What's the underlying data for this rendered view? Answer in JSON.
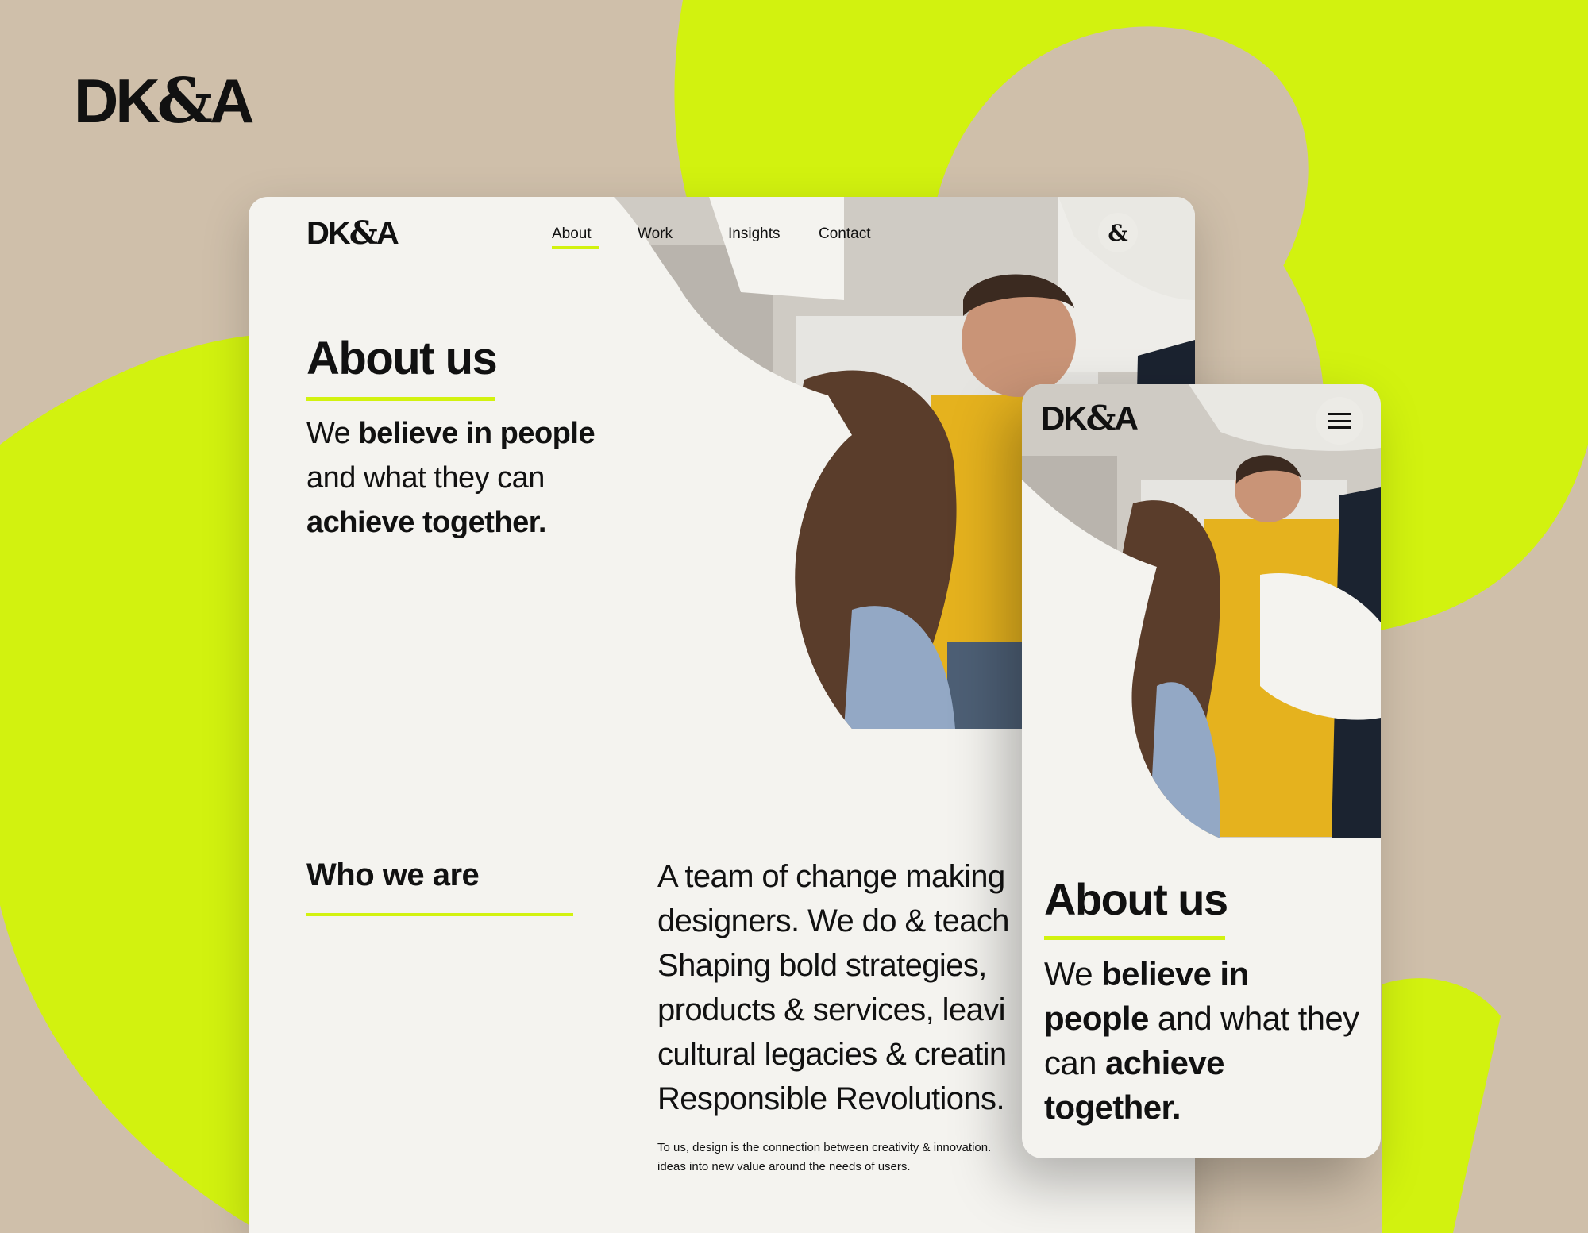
{
  "brand": {
    "logo": {
      "part1": "DK",
      "amp": "&",
      "part2": "A"
    }
  },
  "colors": {
    "background": "#cfbfaa",
    "accent": "#d2f20f",
    "surface": "#f4f3ef",
    "text": "#111111"
  },
  "desktop": {
    "logo": {
      "part1": "DK",
      "amp": "&",
      "part2": "A"
    },
    "nav": {
      "items": [
        {
          "label": "About",
          "active": true
        },
        {
          "label": "Work"
        },
        {
          "label": "Insights"
        },
        {
          "label": "Contact"
        }
      ]
    },
    "badge_icon": "ampersand-icon",
    "badge_glyph": "&",
    "hero": {
      "title": "About us",
      "intro": {
        "t1": "We ",
        "b1": "believe in people",
        "t2": " and what they can ",
        "b2": "achieve together."
      }
    },
    "who": {
      "title": "Who we are",
      "body": "A team of change making\ndesigners. We do & teach\nShaping bold strategies,\nproducts & services, leavi\ncultural legacies & creatin\nResponsible Revolutions.",
      "small": "To us, design is the connection between creativity & innovation.\nideas into new value around the needs of users."
    }
  },
  "mobile": {
    "logo": {
      "part1": "DK",
      "amp": "&",
      "part2": "A"
    },
    "menu_icon": "hamburger-menu-icon",
    "hero": {
      "title": "About us",
      "intro": {
        "t1": "We ",
        "b1": "believe in people",
        "t2": " and what they can ",
        "b2": "achieve",
        "t3": " ",
        "b3": "together."
      }
    }
  }
}
